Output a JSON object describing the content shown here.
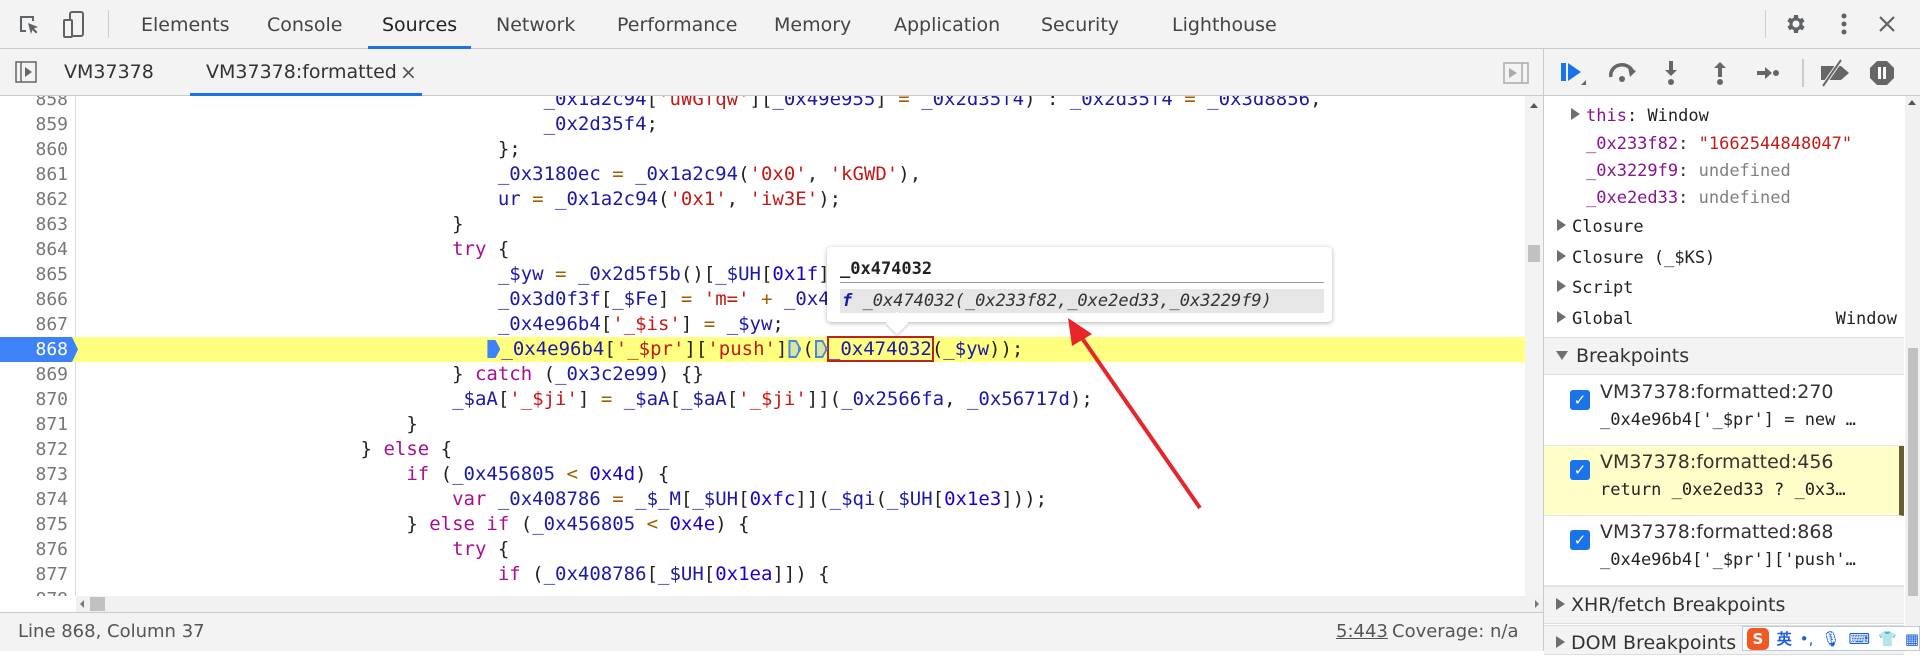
{
  "topbar": {
    "tabs": [
      "Elements",
      "Console",
      "Sources",
      "Network",
      "Performance",
      "Memory",
      "Application",
      "Security",
      "Lighthouse"
    ],
    "active_tab": "Sources"
  },
  "filebar": {
    "tabs": [
      {
        "label": "VM37378"
      },
      {
        "label": "VM37378:formatted",
        "close": "×"
      }
    ]
  },
  "code": {
    "lines": [
      {
        "n": "858",
        "indent": 40,
        "t": [
          [
            "v",
            "_0x1a2c94"
          ],
          [
            "p",
            "["
          ],
          [
            "s",
            "'uWGfqw'"
          ],
          [
            "p",
            "]["
          ],
          [
            "v",
            "_0x49e955"
          ],
          [
            "p",
            "]"
          ],
          [
            "o",
            " = "
          ],
          [
            "v",
            "_0x2d35f4"
          ],
          [
            "p",
            ") : "
          ],
          [
            "v",
            "_0x2d35f4"
          ],
          [
            "o",
            " = "
          ],
          [
            "v",
            "_0x3d8856"
          ],
          [
            "p",
            ","
          ]
        ]
      },
      {
        "n": "859",
        "indent": 40,
        "t": [
          [
            "v",
            "_0x2d35f4"
          ],
          [
            "p",
            ";"
          ]
        ]
      },
      {
        "n": "860",
        "indent": 36,
        "t": [
          [
            "p",
            "};"
          ]
        ]
      },
      {
        "n": "861",
        "indent": 36,
        "t": [
          [
            "v",
            "_0x3180ec"
          ],
          [
            "o",
            " = "
          ],
          [
            "v",
            "_0x1a2c94"
          ],
          [
            "p",
            "("
          ],
          [
            "s",
            "'0x0'"
          ],
          [
            "p",
            ", "
          ],
          [
            "s",
            "'kGWD'"
          ],
          [
            "p",
            "),"
          ]
        ]
      },
      {
        "n": "862",
        "indent": 36,
        "t": [
          [
            "v",
            "ur"
          ],
          [
            "o",
            " = "
          ],
          [
            "v",
            "_0x1a2c94"
          ],
          [
            "p",
            "("
          ],
          [
            "s",
            "'0x1'"
          ],
          [
            "p",
            ", "
          ],
          [
            "s",
            "'iw3E'"
          ],
          [
            "p",
            ");"
          ]
        ]
      },
      {
        "n": "863",
        "indent": 32,
        "t": [
          [
            "p",
            "}"
          ]
        ]
      },
      {
        "n": "864",
        "indent": 32,
        "t": [
          [
            "k",
            "try"
          ],
          [
            "p",
            " {"
          ]
        ]
      },
      {
        "n": "865",
        "indent": 36,
        "t": [
          [
            "v",
            "_$yw"
          ],
          [
            "o",
            " = "
          ],
          [
            "v",
            "_0x2d5f5b"
          ],
          [
            "p",
            "()["
          ],
          [
            "v",
            "_$UH"
          ],
          [
            "p",
            "["
          ],
          [
            "n",
            "0x1f"
          ],
          [
            "p",
            "]"
          ]
        ]
      },
      {
        "n": "866",
        "indent": 36,
        "t": [
          [
            "v",
            "_0x3d0f3f"
          ],
          [
            "p",
            "["
          ],
          [
            "v",
            "_$Fe"
          ],
          [
            "p",
            "]"
          ],
          [
            "o",
            " = "
          ],
          [
            "s",
            "'m='"
          ],
          [
            "o",
            " + "
          ],
          [
            "v",
            "_0x4"
          ]
        ]
      },
      {
        "n": "867",
        "indent": 36,
        "t": [
          [
            "v",
            "_0x4e96b4"
          ],
          [
            "p",
            "["
          ],
          [
            "s",
            "'_$is'"
          ],
          [
            "p",
            "]"
          ],
          [
            "o",
            " = "
          ],
          [
            "v",
            "_$yw"
          ],
          [
            "p",
            ";"
          ]
        ]
      },
      {
        "n": "868",
        "indent": 35,
        "exec": true,
        "t": [
          [
            "bpon",
            ""
          ],
          [
            "v",
            "_0x4e96b4"
          ],
          [
            "p",
            "["
          ],
          [
            "s",
            "'_$pr'"
          ],
          [
            "p",
            "]["
          ],
          [
            "s",
            "'push'"
          ],
          [
            "p",
            "]"
          ],
          [
            "bpoff",
            ""
          ],
          [
            "p",
            "("
          ],
          [
            "bpoff",
            ""
          ],
          [
            "hl",
            "_0x474032"
          ],
          [
            "p",
            "("
          ],
          [
            "v",
            "_$yw"
          ],
          [
            "p",
            "));"
          ]
        ]
      },
      {
        "n": "869",
        "indent": 32,
        "t": [
          [
            "p",
            "} "
          ],
          [
            "k",
            "catch"
          ],
          [
            "p",
            " ("
          ],
          [
            "v",
            "_0x3c2e99"
          ],
          [
            "p",
            ") {}"
          ]
        ]
      },
      {
        "n": "870",
        "indent": 32,
        "t": [
          [
            "v",
            "_$aA"
          ],
          [
            "p",
            "["
          ],
          [
            "s",
            "'_$ji'"
          ],
          [
            "p",
            "]"
          ],
          [
            "o",
            " = "
          ],
          [
            "v",
            "_$aA"
          ],
          [
            "p",
            "["
          ],
          [
            "v",
            "_$aA"
          ],
          [
            "p",
            "["
          ],
          [
            "s",
            "'_$ji'"
          ],
          [
            "p",
            "]]("
          ],
          [
            "v",
            "_0x2566fa"
          ],
          [
            "p",
            ", "
          ],
          [
            "v",
            "_0x56717d"
          ],
          [
            "p",
            ");"
          ]
        ]
      },
      {
        "n": "871",
        "indent": 28,
        "t": [
          [
            "p",
            "}"
          ]
        ]
      },
      {
        "n": "872",
        "indent": 24,
        "t": [
          [
            "p",
            "} "
          ],
          [
            "k",
            "else"
          ],
          [
            "p",
            " {"
          ]
        ]
      },
      {
        "n": "873",
        "indent": 28,
        "t": [
          [
            "k",
            "if"
          ],
          [
            "p",
            " ("
          ],
          [
            "v",
            "_0x456805"
          ],
          [
            "o",
            " < "
          ],
          [
            "n",
            "0x4d"
          ],
          [
            "p",
            ") {"
          ]
        ]
      },
      {
        "n": "874",
        "indent": 32,
        "t": [
          [
            "k",
            "var"
          ],
          [
            "p",
            " "
          ],
          [
            "v",
            "_0x408786"
          ],
          [
            "o",
            " = "
          ],
          [
            "v",
            "_$_M"
          ],
          [
            "p",
            "["
          ],
          [
            "v",
            "_$UH"
          ],
          [
            "p",
            "["
          ],
          [
            "n",
            "0xfc"
          ],
          [
            "p",
            "]]("
          ],
          [
            "v",
            "_$qi"
          ],
          [
            "p",
            "("
          ],
          [
            "v",
            "_$UH"
          ],
          [
            "p",
            "["
          ],
          [
            "n",
            "0x1e3"
          ],
          [
            "p",
            "]));"
          ]
        ]
      },
      {
        "n": "875",
        "indent": 28,
        "t": [
          [
            "p",
            "} "
          ],
          [
            "k",
            "else"
          ],
          [
            "p",
            " "
          ],
          [
            "k",
            "if"
          ],
          [
            "p",
            " ("
          ],
          [
            "v",
            "_0x456805"
          ],
          [
            "o",
            " < "
          ],
          [
            "n",
            "0x4e"
          ],
          [
            "p",
            ") {"
          ]
        ]
      },
      {
        "n": "876",
        "indent": 32,
        "t": [
          [
            "k",
            "try"
          ],
          [
            "p",
            " {"
          ]
        ]
      },
      {
        "n": "877",
        "indent": 36,
        "t": [
          [
            "k",
            "if"
          ],
          [
            "p",
            " ("
          ],
          [
            "v",
            "_0x408786"
          ],
          [
            "p",
            "["
          ],
          [
            "v",
            "_$UH"
          ],
          [
            "p",
            "["
          ],
          [
            "n",
            "0x1ea"
          ],
          [
            "p",
            "]]) {"
          ]
        ]
      },
      {
        "n": "878",
        "indent": 0,
        "t": []
      }
    ]
  },
  "tooltip": {
    "title": "_0x474032",
    "fn_icon": "f",
    "signature": "_0x474032(_0x233f82,_0xe2ed33,_0x3229f9)"
  },
  "status": {
    "position": "Line 868, Column 37",
    "link": "5:443",
    "coverage": "Coverage: n/a"
  },
  "scope": {
    "this_key": "this",
    "this_val": "Window",
    "vars": [
      {
        "key": "_0x233f82",
        "val": "\"1662544848047\"",
        "type": "string"
      },
      {
        "key": "_0x3229f9",
        "val": "undefined",
        "type": "undef"
      },
      {
        "key": "_0xe2ed33",
        "val": "undefined",
        "type": "undef"
      }
    ],
    "groups": [
      {
        "label": "Closure"
      },
      {
        "label": "Closure (_$KS)"
      },
      {
        "label": "Script"
      },
      {
        "label": "Global",
        "value": "Window"
      }
    ]
  },
  "breakpoints": {
    "header": "Breakpoints",
    "items": [
      {
        "location": "VM37378:formatted:270",
        "code": "_0x4e96b4['_$pr'] = new …",
        "checked": true
      },
      {
        "location": "VM37378:formatted:456",
        "code": "return _0xe2ed33 ? _0x3…",
        "checked": true,
        "current": true
      },
      {
        "location": "VM37378:formatted:868",
        "code": "_0x4e96b4['_$pr']['push'…",
        "checked": true
      }
    ],
    "xhr": "XHR/fetch Breakpoints",
    "dom": "DOM Breakpoints"
  },
  "ime": {
    "lang": "英",
    "punct": "•,"
  },
  "colors": {
    "accent": "#1a73e8",
    "exec_line": "#ffff80",
    "annotation_arrow": "#e8262a"
  }
}
